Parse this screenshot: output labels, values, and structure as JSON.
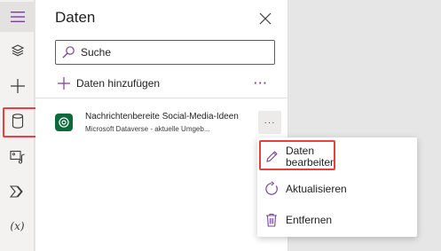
{
  "rail": {
    "items": [
      {
        "name": "hamburger-icon"
      },
      {
        "name": "layers-icon"
      },
      {
        "name": "plus-icon"
      },
      {
        "name": "database-icon"
      },
      {
        "name": "media-icon"
      },
      {
        "name": "power-automate-icon"
      },
      {
        "name": "variables-icon",
        "label": "(x)"
      }
    ]
  },
  "panel": {
    "title": "Daten",
    "search": {
      "placeholder": "Suche"
    },
    "add_label": "Daten hinzufügen",
    "more_label": "···",
    "source": {
      "name": "Nachrichtenbereite Social-Media-Ideen",
      "subtitle": "Microsoft Dataverse - aktuelle Umgeb...",
      "more_label": "···"
    }
  },
  "menu": {
    "edit_label": "Daten\nbearbeiten",
    "edit_line1": "Daten",
    "edit_line2": "bearbeiten",
    "refresh_label": "Aktualisieren",
    "remove_label": "Entfernen"
  },
  "colors": {
    "accent": "#7a3f9d",
    "highlight": "#e8403a",
    "dataverse": "#0b6a3b"
  }
}
